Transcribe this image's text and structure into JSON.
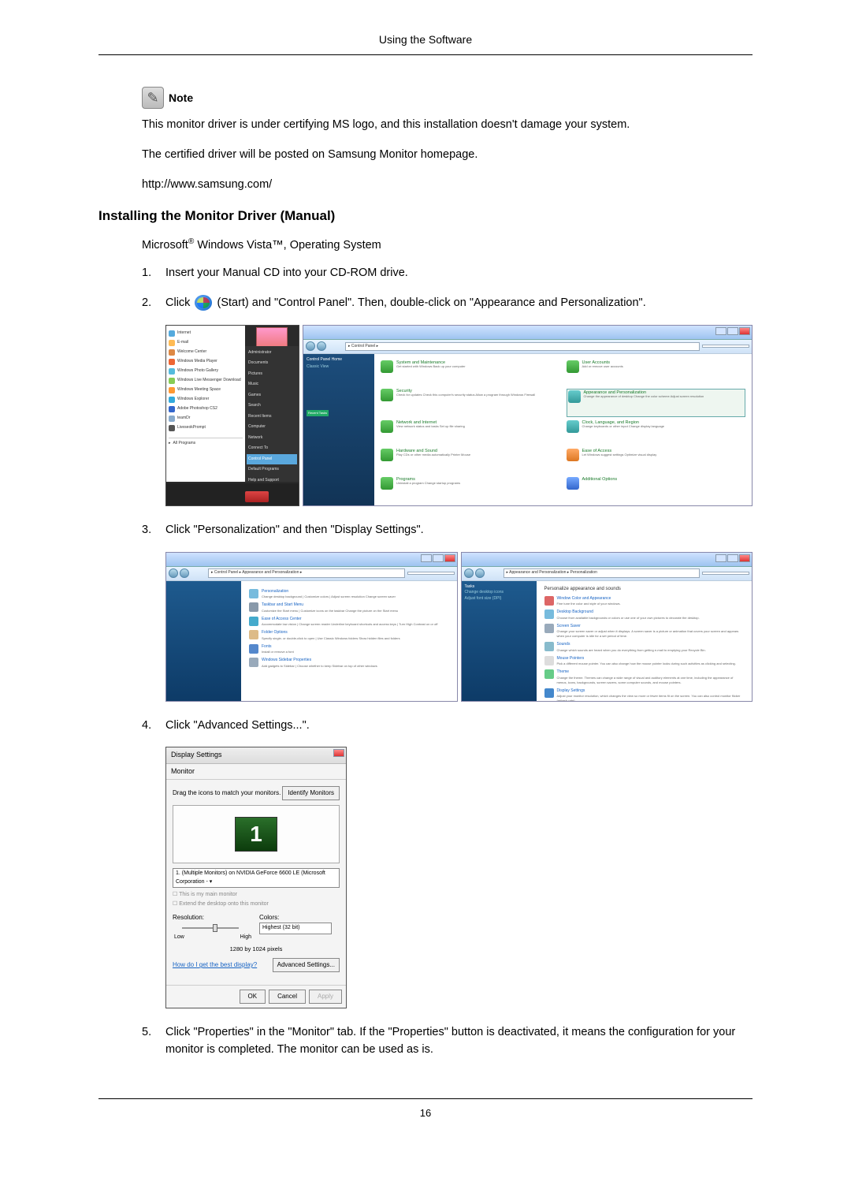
{
  "header": {
    "title": "Using the Software"
  },
  "note": {
    "label": "Note",
    "p1": "This monitor driver is under certifying MS logo, and this installation doesn't damage your system.",
    "p2": "The certified driver will be posted on Samsung Monitor homepage.",
    "p3": "http://www.samsung.com/"
  },
  "section_title": "Installing the Monitor Driver (Manual)",
  "os_line_prefix": "Microsoft",
  "os_line_suffix": " Windows Vista™, Operating System",
  "steps": {
    "s1": {
      "num": "1.",
      "text": "Insert your Manual CD into your CD-ROM drive."
    },
    "s2": {
      "num": "2.",
      "text_a": "Click ",
      "text_b": "(Start) and \"Control Panel\". Then, double-click on \"Appearance and Personalization\"."
    },
    "s3": {
      "num": "3.",
      "text": "Click \"Personalization\" and then \"Display Settings\"."
    },
    "s4": {
      "num": "4.",
      "text": "Click \"Advanced Settings...\"."
    },
    "s5": {
      "num": "5.",
      "text": "Click \"Properties\" in the \"Monitor\" tab. If the \"Properties\" button is deactivated, it means the configuration for your monitor is completed. The monitor can be used as is."
    }
  },
  "vista_start_menu": {
    "left": [
      "Internet",
      "E-mail",
      "Welcome Center",
      "Windows Media Player",
      "Windows Photo Gallery",
      "Windows Live Messenger Download",
      "Windows Meeting Space",
      "Windows Explorer",
      "Adobe Photoshop CS2",
      "teamDr",
      "LiveseokPrompt",
      "All Programs"
    ],
    "right": [
      "Administrator",
      "Documents",
      "Pictures",
      "Music",
      "Games",
      "Search",
      "Recent Items",
      "Computer",
      "Network",
      "Connect To",
      "Control Panel",
      "Default Programs",
      "Help and Support"
    ]
  },
  "control_panel": {
    "addr": "▸ Control Panel ▸",
    "side_head": "Control Panel Home",
    "side_item": "Classic View",
    "recent": "Recent Tasks",
    "categories": [
      {
        "title": "System and Maintenance",
        "sub": "Get started with Windows\nBack up your computer"
      },
      {
        "title": "User Accounts",
        "sub": "Add or remove user accounts"
      },
      {
        "title": "Security",
        "sub": "Check for updates\nCheck this computer's security status\nAllow a program through Windows Firewall"
      },
      {
        "title": "Appearance and Personalization",
        "sub": "Change the appearance of desktop\nChange the color scheme\nAdjust screen resolution"
      },
      {
        "title": "Network and Internet",
        "sub": "View network status and tasks\nSet up file sharing"
      },
      {
        "title": "Clock, Language, and Region",
        "sub": "Change keyboards or other input\nChange display language"
      },
      {
        "title": "Hardware and Sound",
        "sub": "Play CDs or other media automatically\nPrinter\nMouse"
      },
      {
        "title": "Ease of Access",
        "sub": "Let Windows suggest settings\nOptimize visual display"
      },
      {
        "title": "Programs",
        "sub": "Uninstall a program\nChange startup programs"
      },
      {
        "title": "Additional Options",
        "sub": ""
      }
    ]
  },
  "appearance_panel": {
    "addr": "▸ Control Panel ▸ Appearance and Personalization ▸",
    "items": [
      {
        "t": "Personalization",
        "s": "Change desktop background | Customize colors | Adjust screen resolution\nChange screen saver"
      },
      {
        "t": "Taskbar and Start Menu",
        "s": "Customize the Start menu | Customize icons on the taskbar\nChange the picture on the Start menu"
      },
      {
        "t": "Ease of Access Center",
        "s": "Accommodate low vision | Change screen reader\nUnderline keyboard shortcuts and access keys | Turn High Contrast on or off"
      },
      {
        "t": "Folder Options",
        "s": "Specify single- or double-click to open | Use Classic Windows folders\nShow hidden files and folders"
      },
      {
        "t": "Fonts",
        "s": "Install or remove a font"
      },
      {
        "t": "Windows Sidebar Properties",
        "s": "Add gadgets to Sidebar | Choose whether to keep Sidebar on top of other windows"
      }
    ]
  },
  "personalization_panel": {
    "addr": "▸ Appearance and Personalization ▸ Personalization",
    "head": "Personalize appearance and sounds",
    "side": [
      "Tasks",
      "Change desktop icons",
      "Adjust font size (DPI)"
    ],
    "items": [
      {
        "t": "Window Color and Appearance",
        "s": "Fine tune the color and style of your windows."
      },
      {
        "t": "Desktop Background",
        "s": "Choose from available backgrounds or colors or use one of your own pictures to decorate the desktop."
      },
      {
        "t": "Screen Saver",
        "s": "Change your screen saver or adjust when it displays. A screen saver is a picture or animation that covers your screen and appears when your computer is idle for a set period of time."
      },
      {
        "t": "Sounds",
        "s": "Change which sounds are heard when you do everything from getting e-mail to emptying your Recycle Bin."
      },
      {
        "t": "Mouse Pointers",
        "s": "Pick a different mouse pointer. You can also change how the mouse pointer looks during such activities as clicking and selecting."
      },
      {
        "t": "Theme",
        "s": "Change the theme. Themes can change a wide range of visual and auditory elements at one time, including the appearance of menus, icons, backgrounds, screen savers, some computer sounds, and mouse pointers."
      },
      {
        "t": "Display Settings",
        "s": "Adjust your monitor resolution, which changes the view so more or fewer items fit on the screen. You can also control monitor flicker (refresh rate)."
      }
    ]
  },
  "display_settings": {
    "title": "Display Settings",
    "tab": "Monitor",
    "drag_msg": "Drag the icons to match your monitors.",
    "identify": "Identify Monitors",
    "mon_num": "1",
    "selector": "1. (Multiple Monitors) on NVIDIA GeForce 6600 LE (Microsoft Corporation - ▾",
    "chk1": "This is my main monitor",
    "chk2": "Extend the desktop onto this monitor",
    "res_label": "Resolution:",
    "low": "Low",
    "high": "High",
    "res_value": "1280 by 1024 pixels",
    "colors_label": "Colors:",
    "colors_value": "Highest (32 bit)",
    "help_link": "How do I get the best display?",
    "advanced": "Advanced Settings...",
    "ok": "OK",
    "cancel": "Cancel",
    "apply": "Apply"
  },
  "page_number": "16"
}
